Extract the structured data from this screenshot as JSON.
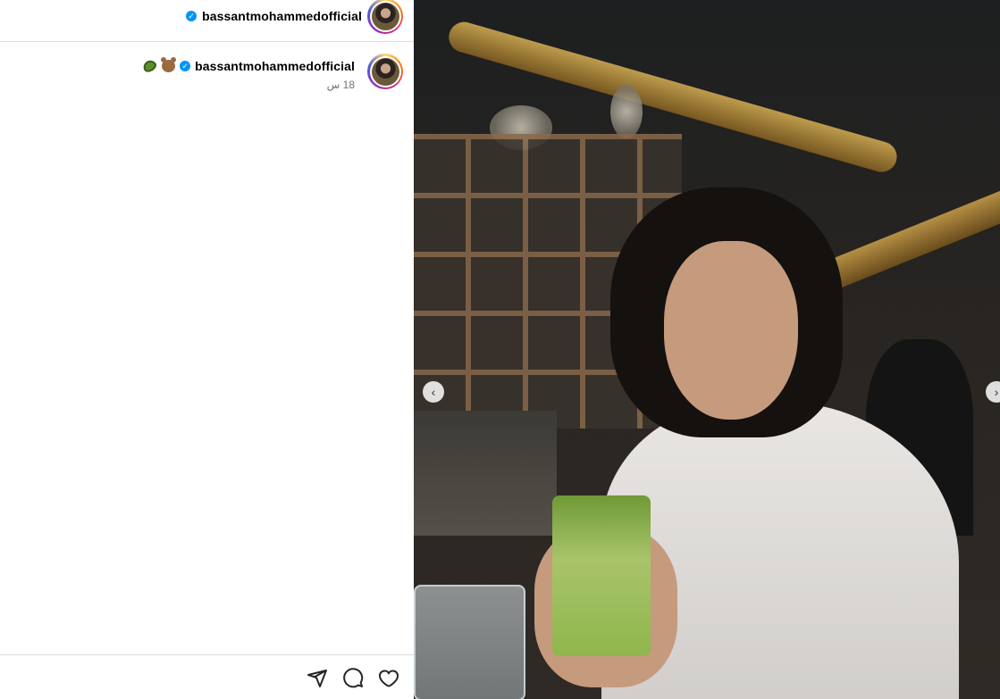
{
  "post": {
    "username": "bassantmohammedofficial",
    "verified": true
  },
  "comment": {
    "username": "bassantmohammedofficial",
    "emojis": [
      "bear-emoji",
      "avocado-emoji"
    ],
    "timestamp": "18 س"
  },
  "actions": {
    "icons": [
      "share-icon",
      "comment-icon",
      "like-icon"
    ]
  },
  "photo": {
    "nav_prev": "‹",
    "nav_next": "›"
  },
  "colors": {
    "verified_blue": "#0095f6",
    "divider": "#dbdbdb",
    "timestamp_gray": "#737373"
  }
}
